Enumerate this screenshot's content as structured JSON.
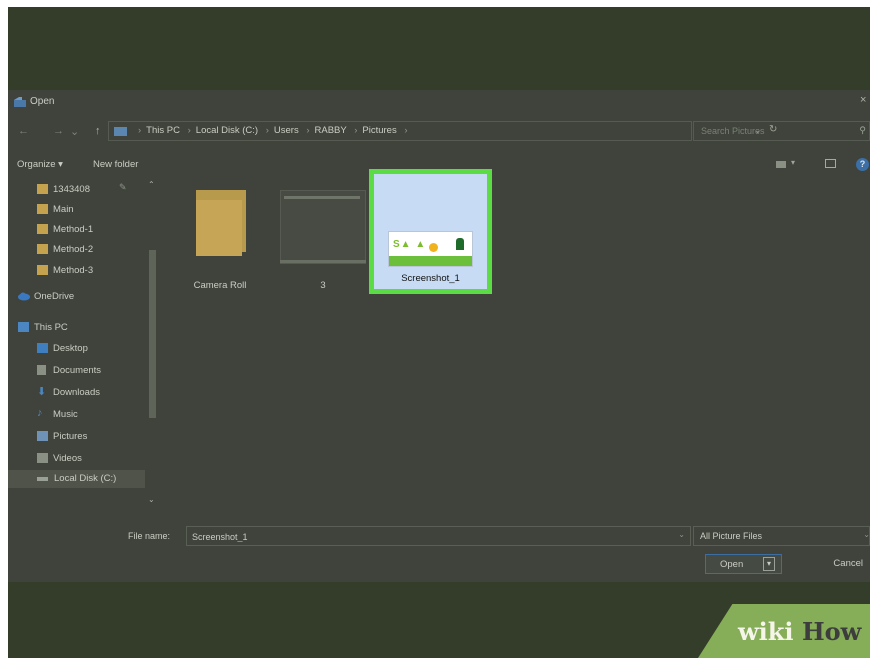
{
  "window": {
    "title": "Open"
  },
  "address": {
    "crumbs": [
      "This PC",
      "Local Disk (C:)",
      "Users",
      "RABBY",
      "Pictures"
    ],
    "search_placeholder": "Search Pictures"
  },
  "toolbar": {
    "organize": "Organize ▾",
    "new_folder": "New folder"
  },
  "nav": {
    "pinned": "1343408",
    "items": [
      "Main",
      "Method-1",
      "Method-2",
      "Method-3",
      "OneDrive",
      "This PC",
      "Desktop",
      "Documents",
      "Downloads",
      "Music",
      "Pictures",
      "Videos",
      "Local Disk (C:)"
    ]
  },
  "files": [
    {
      "name": "Camera Roll",
      "type": "folder"
    },
    {
      "name": "3",
      "type": "image"
    },
    {
      "name": "Screenshot_1",
      "type": "image",
      "selected": true
    }
  ],
  "bottom": {
    "file_name_label": "File name:",
    "file_name_value": "Screenshot_1",
    "filter": "All Picture Files",
    "open": "Open",
    "cancel": "Cancel"
  },
  "watermark": {
    "wiki": "wiki",
    "how": "How"
  },
  "colors": {
    "highlight": "#5bdc45",
    "selection": "#c7dcf4",
    "background": "#343c2a"
  }
}
